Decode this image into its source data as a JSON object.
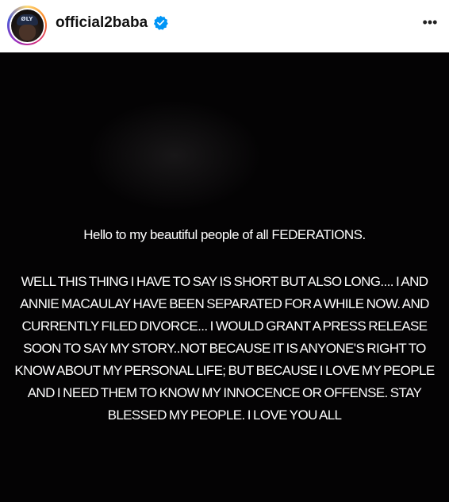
{
  "header": {
    "username": "official2baba",
    "verified": true,
    "avatar_cap_text": "ØLY",
    "more_icon": "more-horizontal-icon",
    "more_glyph": "•••"
  },
  "media": {
    "background_color": "#040304",
    "greeting": "Hello to my beautiful people of all FEDERATIONS.",
    "message": "WELL THIS THING I HAVE TO SAY IS SHORT BUT ALSO LONG.... I AND ANNIE MACAULAY HAVE BEEN SEPARATED FOR A WHILE NOW. AND CURRENTLY FILED DIVORCE... I WOULD GRANT A PRESS RELEASE SOON TO SAY MY STORY..NOT BECAUSE IT IS ANYONE'S RIGHT TO KNOW ABOUT MY PERSONAL LIFE; BUT BECAUSE I LOVE MY PEOPLE AND I NEED THEM TO KNOW MY INNOCENCE OR OFFENSE. STAY BLESSED MY PEOPLE. I LOVE YOU ALL"
  },
  "colors": {
    "verified_badge": "#0095f6",
    "ring_gradient": [
      "#feda75",
      "#fa7e1e",
      "#d62976",
      "#962fbf",
      "#4f5bd5"
    ]
  }
}
